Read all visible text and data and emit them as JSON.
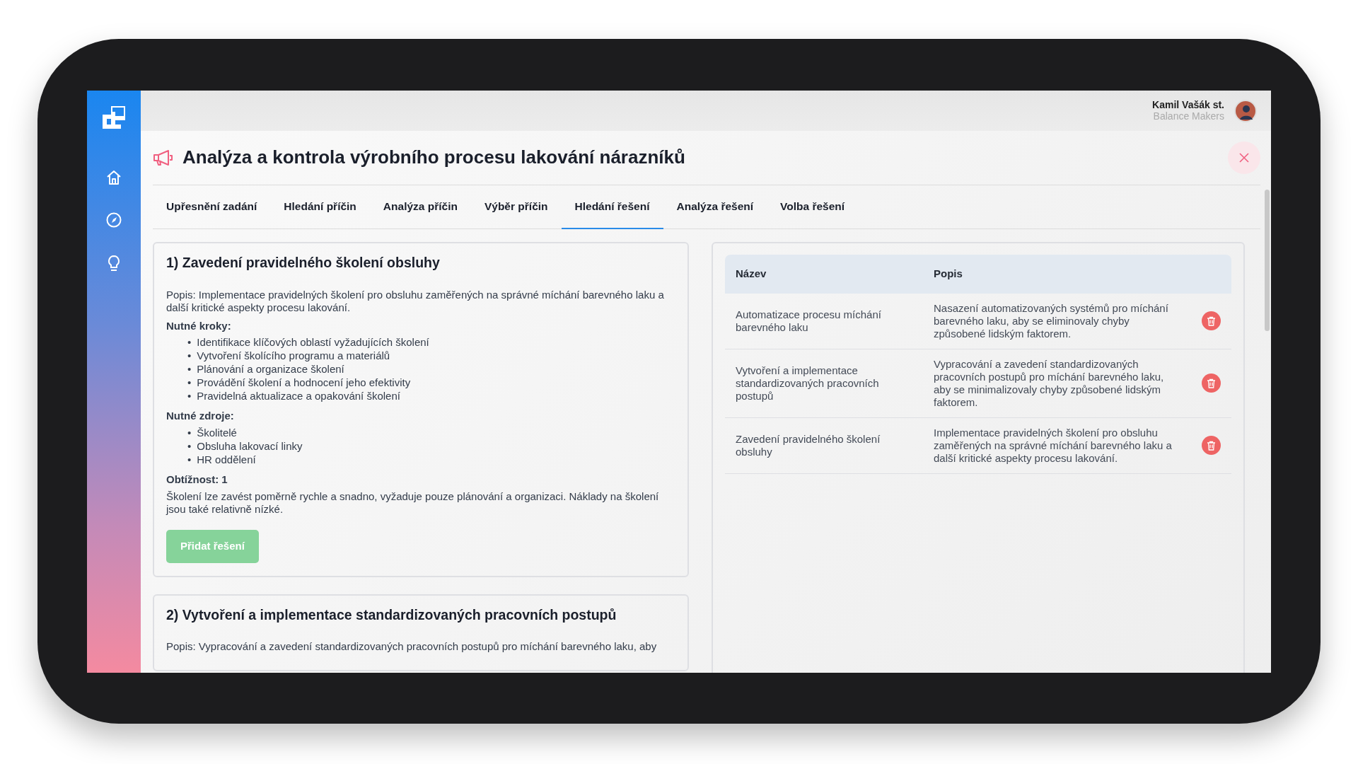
{
  "user": {
    "name": "Kamil Vašák st.",
    "company": "Balance Makers"
  },
  "title": "Analýza a kontrola výrobního procesu lakování nárazníků",
  "tabs": [
    {
      "label": "Upřesnění zadání",
      "selected": false
    },
    {
      "label": "Hledání příčin",
      "selected": false
    },
    {
      "label": "Analýza příčin",
      "selected": false
    },
    {
      "label": "Výběr příčin",
      "selected": false
    },
    {
      "label": "Hledání řešení",
      "selected": true
    },
    {
      "label": "Analýza řešení",
      "selected": false
    },
    {
      "label": "Volba řešení",
      "selected": false
    }
  ],
  "solutions": [
    {
      "title": "1) Zavedení pravidelného školení obsluhy",
      "description": "Popis: Implementace pravidelných školení pro obsluhu zaměřených na správné míchání barevného laku a další kritické aspekty procesu lakování.",
      "sections": [
        {
          "heading": "Nutné kroky:",
          "bullet": "•",
          "items": [
            "Identifikace klíčových oblastí vyžadujících školení",
            "Vytvoření školícího programu a materiálů",
            "Plánování a organizace školení",
            "Provádění školení a hodnocení jeho efektivity",
            "Pravidelná aktualizace a opakování školení"
          ]
        },
        {
          "heading": "Nutné zdroje:",
          "bullet": "•",
          "items": [
            "Školitelé",
            "Obsluha lakovací linky",
            "HR oddělení"
          ]
        }
      ],
      "difficulty": "Obtížnost: 1",
      "note": "Školení lze zavést poměrně rychle a snadno, vyžaduje pouze plánování a organizaci. Náklady na školení jsou také relativně nízké.",
      "button": {
        "label": "Přidat řešení",
        "disabled": true
      }
    },
    {
      "title": "2) Vytvoření a implementace standardizovaných pracovních postupů",
      "description": "Popis: Vypracování a zavedení standardizovaných pracovních postupů pro míchání barevného laku, aby"
    }
  ],
  "table": {
    "columns": [
      "Název",
      "Popis"
    ],
    "rows": [
      {
        "name": "Automatizace procesu míchání barevného laku",
        "description": "Nasazení automatizovaných systémů pro míchání barevného laku, aby se eliminovaly chyby způsobené lidským faktorem."
      },
      {
        "name": "Vytvoření a implementace standardizovaných pracovních postupů",
        "description": "Vypracování a zavedení standardizovaných pracovních postupů pro míchání barevného laku, aby se minimalizovaly chyby způsobené lidským faktorem."
      },
      {
        "name": "Zavedení pravidelného školení obsluhy",
        "description": "Implementace pravidelných školení pro obsluhu zaměřených na správné míchání barevného laku a další kritické aspekty procesu lakování."
      }
    ]
  }
}
